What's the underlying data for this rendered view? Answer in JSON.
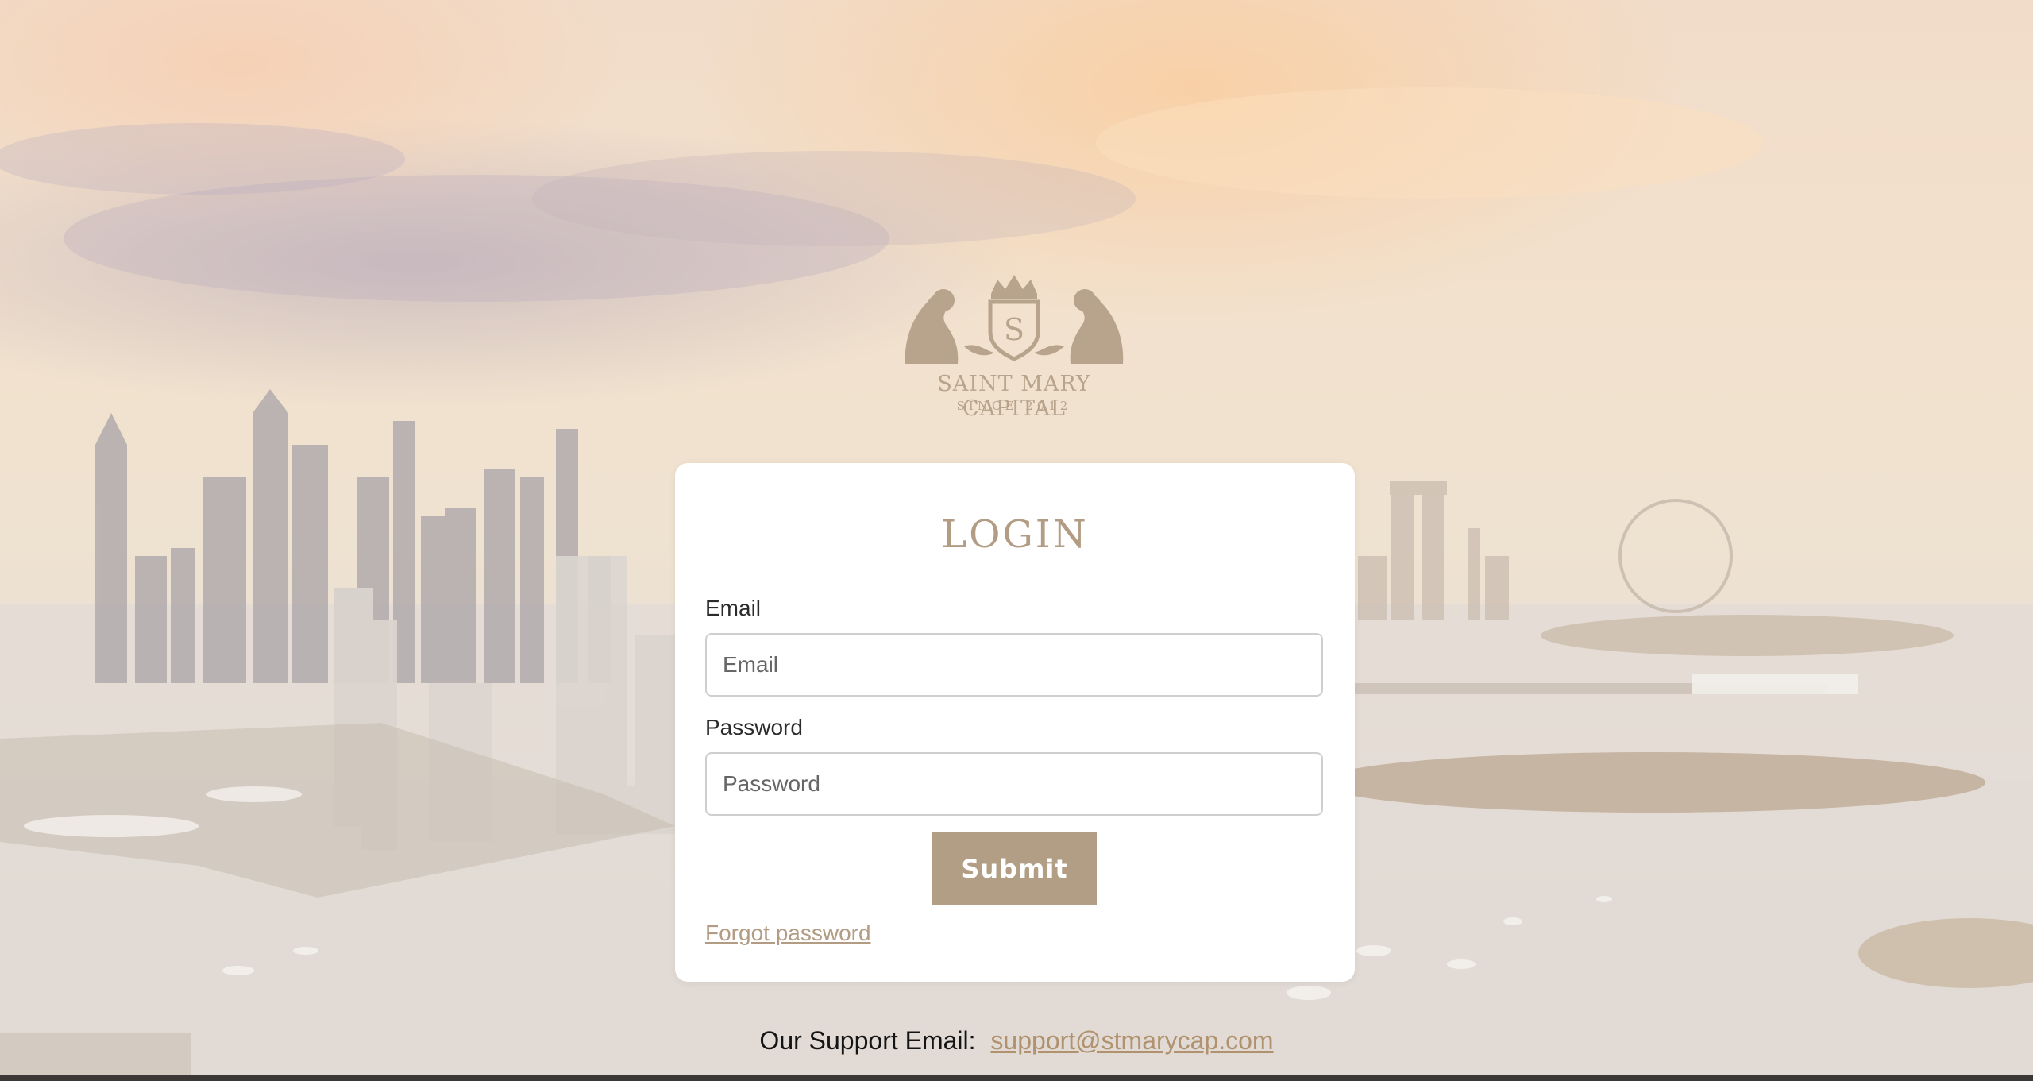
{
  "brand": {
    "name": "SAINT MARY CAPITAL",
    "since": "SINCE 2012",
    "monogram": "S"
  },
  "login_form": {
    "title": "LOGIN",
    "email_label": "Email",
    "email_placeholder": "Email",
    "email_value": "",
    "password_label": "Password",
    "password_placeholder": "Password",
    "password_value": "",
    "submit_label": "Submit",
    "forgot_label": "Forgot password"
  },
  "support": {
    "label": "Our Support Email:",
    "email": "support@stmarycap.com"
  },
  "colors": {
    "accent": "#b29e85",
    "link": "#b0926e",
    "card": "#ffffff"
  },
  "icons": [
    "lion-crest-icon",
    "crown-icon",
    "shield-icon"
  ]
}
